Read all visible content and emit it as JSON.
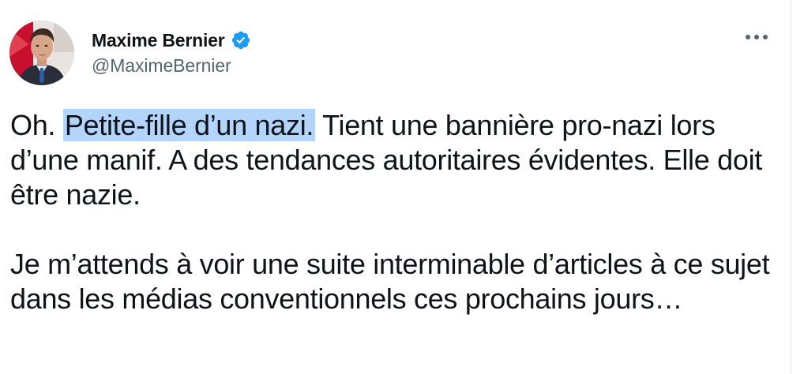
{
  "author": {
    "display_name": "Maxime Bernier",
    "handle": "@MaximeBernier",
    "avatar_icon": "profile-photo",
    "verified_icon": "verified-badge-icon",
    "verified_color": "#1d9bf0"
  },
  "more_icon": "more-horizontal-icon",
  "tweet": {
    "para1_prefix": "Oh. ",
    "para1_highlight": "Petite-fille d’un nazi.",
    "para1_suffix": " Tient une bannière pro-nazi lors d’une manif. A des tendances autoritaires évidentes. Elle doit être nazie.",
    "para2": "Je m’attends à voir une suite interminable d’articles à ce sujet dans les médias conventionnels ces prochains jours…",
    "highlight_color": "#b3d4fc"
  },
  "colors": {
    "text_primary": "#0f1419",
    "text_secondary": "#536471",
    "background": "#ffffff"
  }
}
